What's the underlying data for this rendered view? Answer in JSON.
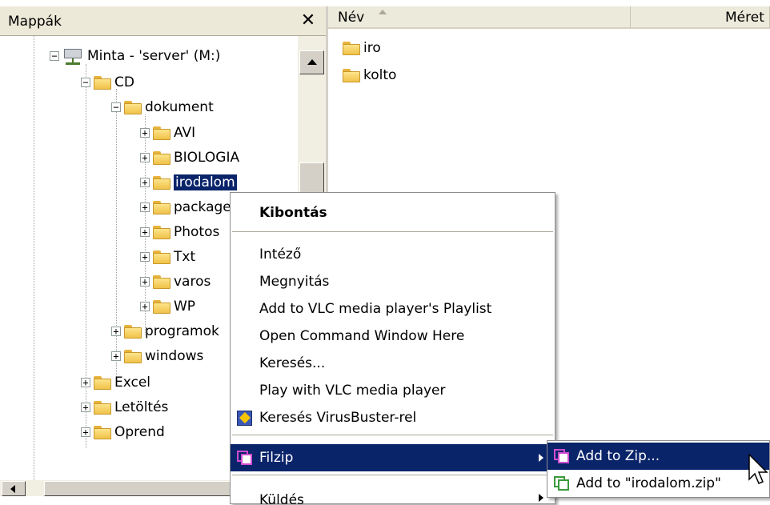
{
  "folders_pane": {
    "title": "Mappák",
    "close_glyph": "✕",
    "tree": [
      {
        "label": "Minta - 'server' (M:)",
        "icon": "network-drive-icon",
        "expander": "−"
      },
      {
        "label": "CD",
        "icon": "folder-icon",
        "expander": "−"
      },
      {
        "label": "dokument",
        "icon": "folder-icon",
        "expander": "−"
      },
      {
        "label": "AVI",
        "icon": "folder-icon",
        "expander": "+"
      },
      {
        "label": "BIOLOGIA",
        "icon": "folder-icon",
        "expander": "+"
      },
      {
        "label": "irodalom",
        "icon": "folder-icon",
        "expander": "+",
        "selected": true
      },
      {
        "label": "packages",
        "icon": "folder-icon",
        "expander": "+"
      },
      {
        "label": "Photos",
        "icon": "folder-icon",
        "expander": "+"
      },
      {
        "label": "Txt",
        "icon": "folder-icon",
        "expander": "+"
      },
      {
        "label": "varos",
        "icon": "folder-icon",
        "expander": "+"
      },
      {
        "label": "WP",
        "icon": "folder-icon",
        "expander": "+"
      },
      {
        "label": "programok",
        "icon": "folder-icon",
        "expander": "+"
      },
      {
        "label": "windows",
        "icon": "folder-icon",
        "expander": "+"
      },
      {
        "label": "Excel",
        "icon": "folder-icon",
        "expander": "+"
      },
      {
        "label": "Letöltés",
        "icon": "folder-icon",
        "expander": "+"
      },
      {
        "label": "Oprend",
        "icon": "folder-icon",
        "expander": "+"
      }
    ]
  },
  "file_list": {
    "columns": [
      "Név",
      "Méret"
    ],
    "rows": [
      "iro",
      "kolto"
    ]
  },
  "context_menu": {
    "items": [
      {
        "label": "Kibontás",
        "bold": true
      },
      {
        "separator": true
      },
      {
        "label": "Intéző"
      },
      {
        "label": "Megnyitás"
      },
      {
        "label": "Add to VLC media player's Playlist"
      },
      {
        "label": "Open Command Window Here"
      },
      {
        "label": "Keresés..."
      },
      {
        "label": "Play with VLC media player"
      },
      {
        "label": "Keresés VirusBuster-rel",
        "icon": "virusbuster-icon"
      },
      {
        "separator": true
      },
      {
        "label": "Filzip",
        "icon": "filzip-icon",
        "submenu": true,
        "highlighted": true
      },
      {
        "separator": true
      },
      {
        "label": "Küldés",
        "submenu": true
      }
    ]
  },
  "submenu": {
    "items": [
      {
        "label": "Add to Zip...",
        "highlighted": true,
        "icon": "filzip-icon"
      },
      {
        "label": "Add to \"irodalom.zip\"",
        "icon": "filzip-green-icon"
      }
    ]
  },
  "colors": {
    "selection": "#0a246a",
    "toolbar_bg": "#ece9d8",
    "folder_yellow": "#f0c24a"
  }
}
